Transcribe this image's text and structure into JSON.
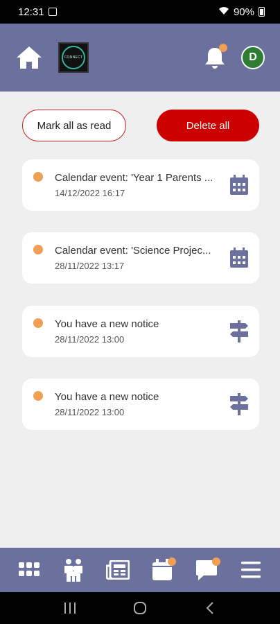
{
  "status_bar": {
    "time": "12:31",
    "battery": "90%"
  },
  "header": {
    "logo_text": "CONNECT",
    "avatar_initial": "D",
    "colors": {
      "header_bg": "#6c709c",
      "badge": "#f0a055",
      "avatar_bg": "#2e7d32"
    }
  },
  "actions": {
    "mark_all_label": "Mark all as read",
    "delete_all_label": "Delete all"
  },
  "notifications": [
    {
      "title": "Calendar event: 'Year 1 Parents ...",
      "time": "14/12/2022 16:17",
      "icon": "calendar-icon",
      "unread": true
    },
    {
      "title": "Calendar event: 'Science Projec...",
      "time": "28/11/2022 13:17",
      "icon": "calendar-icon",
      "unread": true
    },
    {
      "title": "You have a new notice",
      "time": "28/11/2022 13:00",
      "icon": "signpost-icon",
      "unread": true
    },
    {
      "title": "You have a new notice",
      "time": "28/11/2022 13:00",
      "icon": "signpost-icon",
      "unread": true
    }
  ],
  "bottom_nav": [
    {
      "icon": "apps-grid-icon",
      "badge": false
    },
    {
      "icon": "family-icon",
      "badge": false
    },
    {
      "icon": "newspaper-icon",
      "badge": false
    },
    {
      "icon": "calendar-icon",
      "badge": true
    },
    {
      "icon": "chat-icon",
      "badge": true
    },
    {
      "icon": "menu-icon",
      "badge": false
    }
  ]
}
